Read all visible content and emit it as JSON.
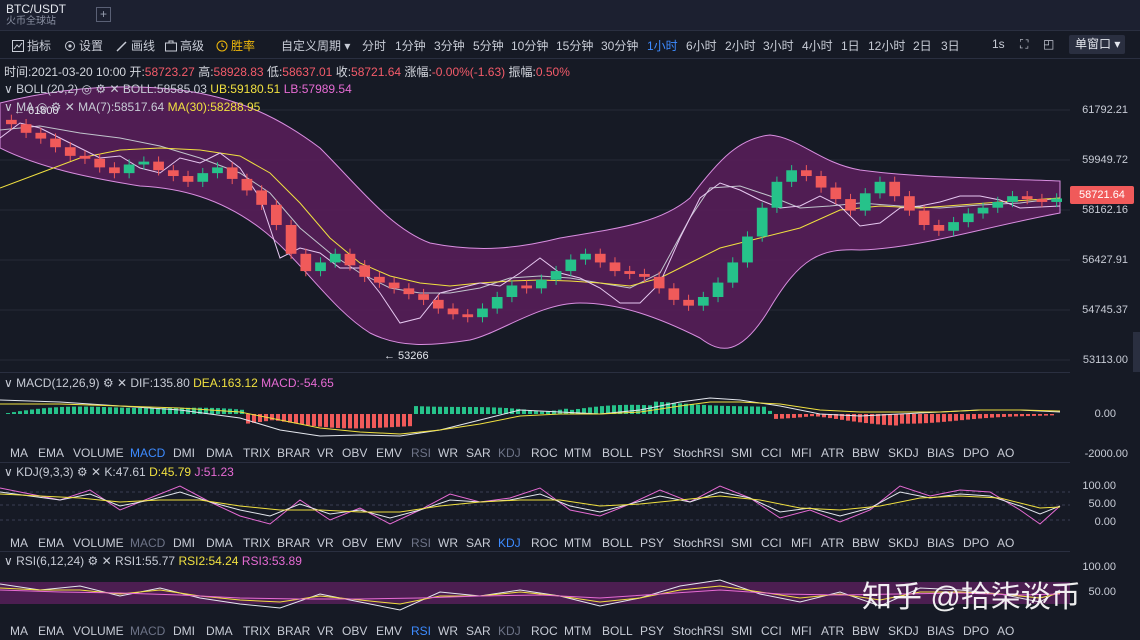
{
  "header": {
    "symbol": "BTC/USDT",
    "exchange": "火币全球站",
    "add_tab": "+"
  },
  "toolbar": {
    "indicator": "指标",
    "settings": "设置",
    "draw": "画线",
    "advanced": "高级",
    "win_rate": "胜率",
    "custom_period": "自定义周期",
    "periods": [
      "分时",
      "1分钟",
      "3分钟",
      "5分钟",
      "10分钟",
      "15分钟",
      "30分钟",
      "1小时",
      "6小时",
      "2小时",
      "3小时",
      "4小时",
      "1日",
      "12小时",
      "2日",
      "3日"
    ],
    "active_period": "1小时",
    "refresh": "1s",
    "window": "单窗口"
  },
  "ohlc": {
    "time_label": "时间:",
    "time": "2021-03-20 10:00",
    "open_label": "开:",
    "open": "58723.27",
    "high_label": "高:",
    "high": "58928.83",
    "low_label": "低:",
    "low": "58637.01",
    "close_label": "收:",
    "close": "58721.64",
    "change_label": "涨幅:",
    "change": "-0.00%(-1.63)",
    "amp_label": "振幅:",
    "amp": "0.50%"
  },
  "boll": {
    "name": "BOLL(20,2)",
    "mid": "BOLL:58585.03",
    "ub": "UB:59180.51",
    "lb": "LB:57989.54"
  },
  "ma": {
    "name": "MA",
    "ma7": "MA(7):58517.64",
    "ma30": "MA(30):58288.95"
  },
  "price_axis": [
    "61792.21",
    "59949.72",
    "58162.16",
    "56427.91",
    "54745.37",
    "53113.00"
  ],
  "last_price": "58721.64",
  "annotations": {
    "high": "← 61800",
    "low": "← 53266"
  },
  "macd": {
    "name": "MACD(12,26,9)",
    "dif": "DIF:135.80",
    "dea": "DEA:163.12",
    "macd": "MACD:-54.65",
    "axis": [
      "0.00",
      "-2000.00"
    ]
  },
  "kdj": {
    "name": "KDJ(9,3,3)",
    "k": "K:47.61",
    "d": "D:45.79",
    "j": "J:51.23",
    "axis": [
      "100.00",
      "50.00",
      "0.00"
    ]
  },
  "rsi": {
    "name": "RSI(6,12,24)",
    "r1": "RSI1:55.77",
    "r2": "RSI2:54.24",
    "r3": "RSI3:53.89",
    "axis": [
      "100.00",
      "50.00"
    ]
  },
  "indicator_tabs": [
    "MA",
    "EMA",
    "VOLUME",
    "MACD",
    "DMI",
    "DMA",
    "TRIX",
    "BRAR",
    "VR",
    "OBV",
    "EMV",
    "RSI",
    "WR",
    "SAR",
    "KDJ",
    "ROC",
    "MTM",
    "BOLL",
    "PSY",
    "StochRSI",
    "SMI",
    "CCI",
    "MFI",
    "ATR",
    "BBW",
    "SKDJ",
    "BIAS",
    "DPO",
    "AO"
  ],
  "watermark": "知乎 @拾柒谈币",
  "colors": {
    "up": "#26c28a",
    "down": "#f05a5a",
    "active": "#3d8bff",
    "boll_fill": "#5a1f5c",
    "bg": "#161a25"
  },
  "chart_data": {
    "type": "candlestick",
    "title": "BTC/USDT 1小时",
    "ylim": [
      53113,
      61792.21
    ],
    "close_series_approx": [
      61300,
      61000,
      60800,
      60500,
      60200,
      60100,
      59800,
      59600,
      59900,
      60000,
      59700,
      59500,
      59300,
      59600,
      59800,
      59400,
      59000,
      58500,
      57800,
      56800,
      56200,
      56500,
      56800,
      56400,
      56000,
      55800,
      55600,
      55400,
      55200,
      54900,
      54700,
      54600,
      54900,
      55300,
      55700,
      55600,
      55900,
      56200,
      56600,
      56800,
      56500,
      56200,
      56100,
      56000,
      55600,
      55200,
      55000,
      55300,
      55800,
      56500,
      57400,
      58400,
      59300,
      59700,
      59500,
      59100,
      58700,
      58300,
      58900,
      59300,
      58800,
      58300,
      57800,
      57600,
      57900,
      58200,
      58400,
      58600,
      58800,
      58700,
      58600,
      58721.64
    ]
  }
}
